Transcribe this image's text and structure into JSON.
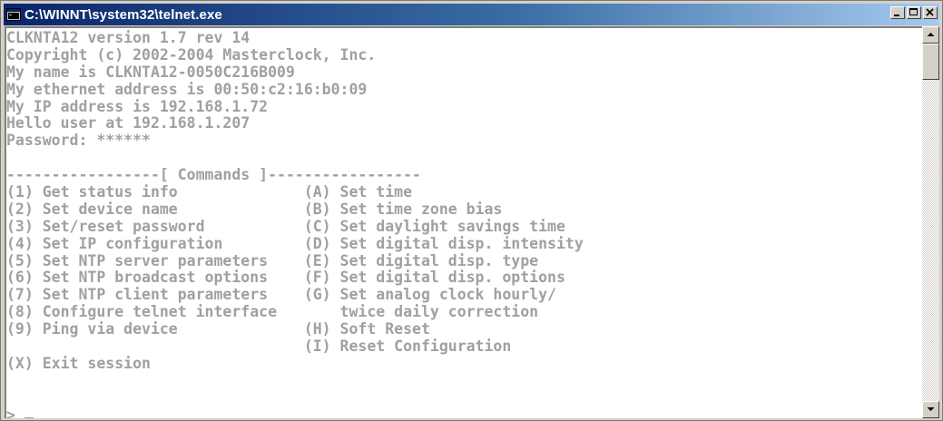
{
  "window": {
    "title": "C:\\WINNT\\system32\\telnet.exe",
    "icon": "console-window-icon",
    "controls": [
      "minimize",
      "maximize",
      "close"
    ]
  },
  "console": {
    "lines": [
      "CLKNTA12 version 1.7 rev 14",
      "Copyright (c) 2002-2004 Masterclock, Inc.",
      "My name is CLKNTA12-0050C216B009",
      "My ethernet address is 00:50:c2:16:b0:09",
      "My IP address is 192.168.1.72",
      "Hello user at 192.168.1.207",
      "Password: ******",
      "",
      "-----------------[ Commands ]-----------------",
      "(1) Get status info              (A) Set time",
      "(2) Set device name              (B) Set time zone bias",
      "(3) Set/reset password           (C) Set daylight savings time",
      "(4) Set IP configuration         (D) Set digital disp. intensity",
      "(5) Set NTP server parameters    (E) Set digital disp. type",
      "(6) Set NTP broadcast options    (F) Set digital disp. options",
      "(7) Set NTP client parameters    (G) Set analog clock hourly/",
      "(8) Configure telnet interface       twice daily correction",
      "(9) Ping via device              (H) Soft Reset",
      "                                 (I) Reset Configuration",
      "(X) Exit session",
      "",
      ""
    ],
    "prompt": "> ",
    "text_color": "#a0a0a0",
    "background_color": "#ffffff"
  },
  "colors": {
    "titlebar_start": "#0a246a",
    "titlebar_end": "#a6caf0",
    "chrome": "#d4d0c8"
  }
}
